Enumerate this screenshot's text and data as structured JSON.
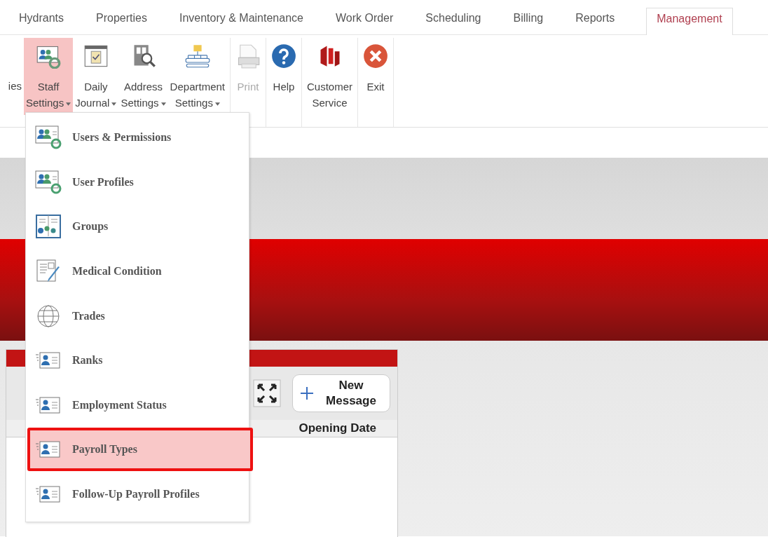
{
  "tabs": [
    {
      "label": "Hydrants",
      "selected": false
    },
    {
      "label": "Properties",
      "selected": false
    },
    {
      "label": "Inventory & Maintenance",
      "selected": false
    },
    {
      "label": "Work Order",
      "selected": false
    },
    {
      "label": "Scheduling",
      "selected": false
    },
    {
      "label": "Billing",
      "selected": false
    },
    {
      "label": "Reports",
      "selected": false
    },
    {
      "label": "Management",
      "selected": true
    }
  ],
  "ribbon_groups": [
    {
      "buttons": [
        {
          "lines": [
            "ies"
          ],
          "kind": "none",
          "dropdown": false,
          "selected": false,
          "disabled": false
        },
        {
          "lines": [
            "Staff",
            "Settings"
          ],
          "kind": "staff",
          "dropdown": true,
          "selected": true,
          "disabled": false
        },
        {
          "lines": [
            "Daily",
            "Journal"
          ],
          "kind": "journal",
          "dropdown": true,
          "selected": false,
          "disabled": false
        },
        {
          "lines": [
            "Address",
            "Settings"
          ],
          "kind": "address",
          "dropdown": true,
          "selected": false,
          "disabled": false
        },
        {
          "lines": [
            "Department",
            "Settings"
          ],
          "kind": "department",
          "dropdown": true,
          "selected": false,
          "disabled": false
        }
      ]
    },
    {
      "buttons": [
        {
          "lines": [
            "Print"
          ],
          "kind": "print",
          "dropdown": false,
          "selected": false,
          "disabled": true
        }
      ]
    },
    {
      "buttons": [
        {
          "lines": [
            "Help"
          ],
          "kind": "help",
          "dropdown": false,
          "selected": false,
          "disabled": false
        }
      ]
    },
    {
      "buttons": [
        {
          "lines": [
            "Customer",
            "Service"
          ],
          "kind": "service",
          "dropdown": false,
          "selected": false,
          "disabled": false
        }
      ]
    },
    {
      "buttons": [
        {
          "lines": [
            "Exit"
          ],
          "kind": "exit",
          "dropdown": false,
          "selected": false,
          "disabled": false
        }
      ]
    }
  ],
  "staff_menu": [
    {
      "label": "Users & Permissions",
      "kind": "users",
      "selected": false
    },
    {
      "label": "User Profiles",
      "kind": "users",
      "selected": false
    },
    {
      "label": "Groups",
      "kind": "groups",
      "selected": false
    },
    {
      "label": "Medical Condition",
      "kind": "medical",
      "selected": false
    },
    {
      "label": "Trades",
      "kind": "globe",
      "selected": false
    },
    {
      "label": "Ranks",
      "kind": "card",
      "selected": false
    },
    {
      "label": "Employment Status",
      "kind": "card",
      "selected": false
    },
    {
      "label": "Payroll Types",
      "kind": "card",
      "selected": true
    },
    {
      "label": "Follow-Up Payroll Profiles",
      "kind": "card",
      "selected": false
    }
  ],
  "panel": {
    "new_message_button": "New Message",
    "column": "Opening Date"
  }
}
